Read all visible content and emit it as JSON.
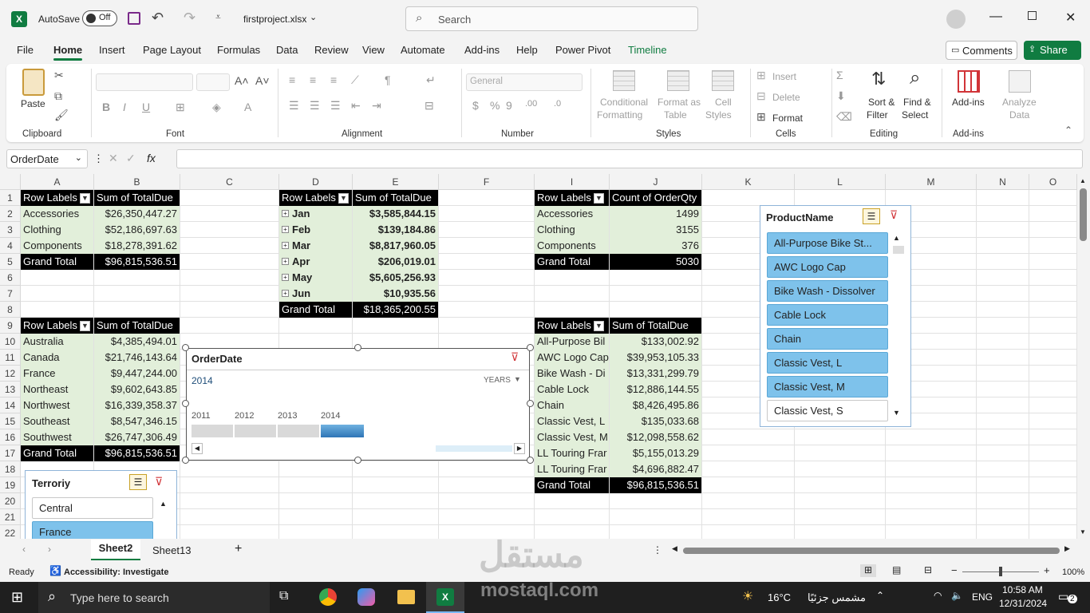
{
  "title": {
    "autosave": "AutoSave",
    "autosave_state": "Off",
    "file_name": "firstproject.xlsx",
    "search_placeholder": "Search"
  },
  "menu": {
    "items": [
      "File",
      "Home",
      "Insert",
      "Page Layout",
      "Formulas",
      "Data",
      "Review",
      "View",
      "Automate",
      "Add-ins",
      "Help",
      "Power Pivot",
      "Timeline"
    ],
    "active": "Home",
    "comments": "Comments",
    "share": "Share"
  },
  "ribbon": {
    "paste": "Paste",
    "clipboard": "Clipboard",
    "font": "Font",
    "alignment": "Alignment",
    "number_format": "General",
    "number": "Number",
    "cond_fmt_1": "Conditional",
    "cond_fmt_2": "Formatting",
    "format_table_1": "Format as",
    "format_table_2": "Table",
    "cell_styles_1": "Cell",
    "cell_styles_2": "Styles",
    "styles": "Styles",
    "insert": "Insert",
    "delete": "Delete",
    "format": "Format",
    "cells": "Cells",
    "sort_filter_1": "Sort &",
    "sort_filter_2": "Filter",
    "find_select_1": "Find &",
    "find_select_2": "Select",
    "editing": "Editing",
    "addins": "Add-ins",
    "addins_group": "Add-ins",
    "analyze_1": "Analyze",
    "analyze_2": "Data"
  },
  "formula_bar": {
    "name_box": "OrderDate",
    "fx": "fx"
  },
  "columns": [
    "A",
    "B",
    "C",
    "D",
    "E",
    "F",
    "I",
    "J",
    "K",
    "L",
    "M",
    "N",
    "O"
  ],
  "rows": [
    "1",
    "2",
    "3",
    "4",
    "5",
    "6",
    "7",
    "8",
    "9",
    "10",
    "11",
    "12",
    "13",
    "14",
    "15",
    "16",
    "17",
    "18",
    "19",
    "20",
    "21",
    "22"
  ],
  "pivot1": {
    "h1": "Row Labels",
    "h2": "Sum of TotalDue",
    "rows": [
      [
        "Accessories",
        "$26,350,447.27"
      ],
      [
        "Clothing",
        "$52,186,697.63"
      ],
      [
        "Components",
        "$18,278,391.62"
      ]
    ],
    "total": [
      "Grand Total",
      "$96,815,536.51"
    ]
  },
  "pivot2": {
    "h1": "Row Labels",
    "h2": "Sum of TotalDue",
    "rows": [
      [
        "Jan",
        "$3,585,844.15"
      ],
      [
        "Feb",
        "$139,184.86"
      ],
      [
        "Mar",
        "$8,817,960.05"
      ],
      [
        "Apr",
        "$206,019.01"
      ],
      [
        "May",
        "$5,605,256.93"
      ],
      [
        "Jun",
        "$10,935.56"
      ]
    ],
    "total": [
      "Grand Total",
      "$18,365,200.55"
    ]
  },
  "pivot3": {
    "h1": "Row Labels",
    "h2": "Count of OrderQty",
    "rows": [
      [
        "Accessories",
        "1499"
      ],
      [
        "Clothing",
        "3155"
      ],
      [
        "Components",
        "376"
      ]
    ],
    "total": [
      "Grand Total",
      "5030"
    ]
  },
  "pivot4": {
    "h1": "Row Labels",
    "h2": "Sum of TotalDue",
    "rows": [
      [
        "Australia",
        "$4,385,494.01"
      ],
      [
        "Canada",
        "$21,746,143.64"
      ],
      [
        "France",
        "$9,447,244.00"
      ],
      [
        "Northeast",
        "$9,602,643.85"
      ],
      [
        "Northwest",
        "$16,339,358.37"
      ],
      [
        "Southeast",
        "$8,547,346.15"
      ],
      [
        "Southwest",
        "$26,747,306.49"
      ]
    ],
    "total": [
      "Grand Total",
      "$96,815,536.51"
    ]
  },
  "pivot5": {
    "h1": "Row Labels",
    "h2": "Sum of TotalDue",
    "rows": [
      [
        "All-Purpose Bil",
        "$133,002.92"
      ],
      [
        "AWC Logo Cap",
        "$39,953,105.33"
      ],
      [
        "Bike Wash - Di",
        "$13,331,299.79"
      ],
      [
        "Cable Lock",
        "$12,886,144.55"
      ],
      [
        "Chain",
        "$8,426,495.86"
      ],
      [
        "Classic Vest, L",
        "$135,033.68"
      ],
      [
        "Classic Vest, M",
        "$12,098,558.62"
      ],
      [
        "LL Touring Frar",
        "$5,155,013.29"
      ],
      [
        "LL Touring Frar",
        "$4,696,882.47"
      ]
    ],
    "total": [
      "Grand Total",
      "$96,815,536.51"
    ]
  },
  "timeline": {
    "title": "OrderDate",
    "selection": "2014",
    "level": "YEARS",
    "years": [
      "2011",
      "2012",
      "2013",
      "2014"
    ]
  },
  "slicer_territory": {
    "title": "Terroriy",
    "items": [
      "Central",
      "France"
    ]
  },
  "slicer_product": {
    "title": "ProductName",
    "items": [
      "All-Purpose Bike St...",
      "AWC Logo Cap",
      "Bike Wash - Dissolver",
      "Cable Lock",
      "Chain",
      "Classic Vest, L",
      "Classic Vest, M",
      "Classic Vest, S"
    ]
  },
  "sheets": {
    "tabs": [
      "Sheet2",
      "Sheet13"
    ],
    "active": "Sheet2"
  },
  "status": {
    "ready": "Ready",
    "accessibility": "Accessibility: Investigate",
    "zoom": "100%"
  },
  "taskbar": {
    "search": "Type here to search",
    "weather": "16°C",
    "weather_desc": "مشمس جزئيًا",
    "lang": "ENG",
    "time": "10:58 AM",
    "date": "12/31/2024",
    "notifications": "2"
  },
  "watermark": {
    "text": "mostaql.com",
    "logo": "مستقل"
  },
  "colors": {
    "accent": "#107c41",
    "pivot_green": "#e2efda",
    "slicer_selected": "#7ec2eb"
  }
}
